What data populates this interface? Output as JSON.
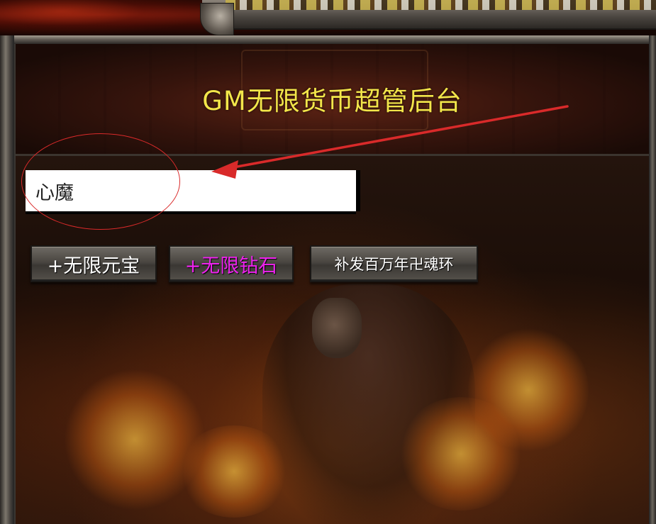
{
  "header": {
    "title": "GM无限货币超管后台"
  },
  "form": {
    "player_name_value": "心魔"
  },
  "actions": {
    "yuanbao_label": "+无限元宝",
    "diamond_label": "+无限钻石",
    "reissue_label": "补发百万年卍魂环"
  },
  "colors": {
    "title": "#f3e64a",
    "diamond_text": "#ee22ee",
    "annotation": "#d92a2a"
  }
}
